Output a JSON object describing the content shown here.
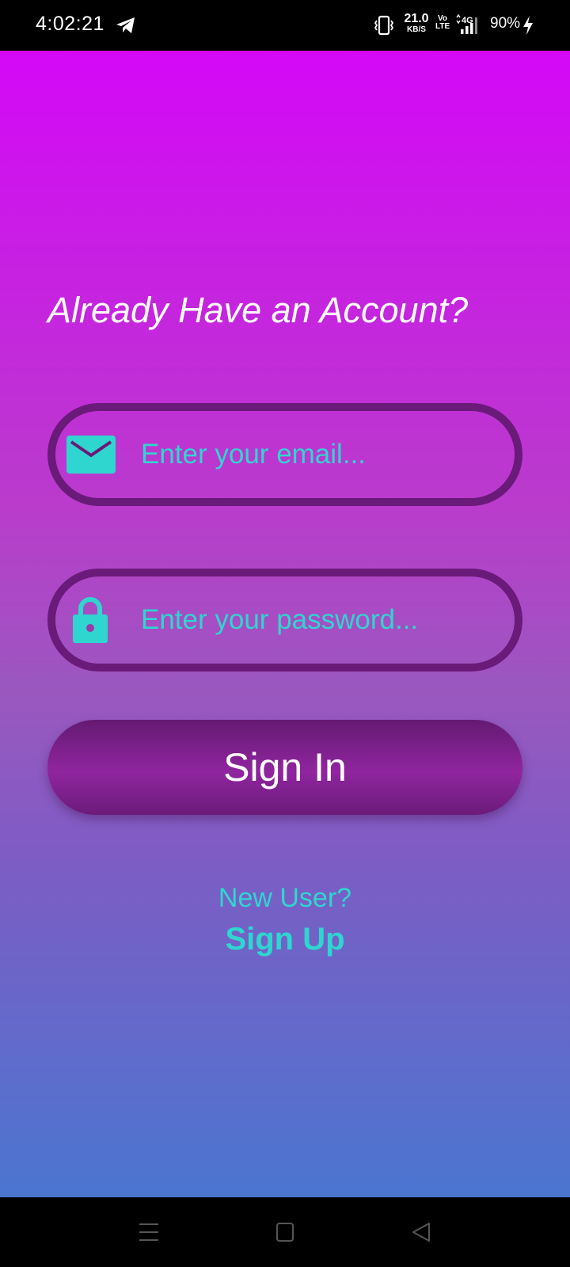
{
  "status_bar": {
    "time": "4:02:21",
    "speed_value": "21.0",
    "speed_unit": "KB/S",
    "volte_top": "Vo",
    "volte_bottom": "LTE",
    "network_type": "4G",
    "battery": "90%",
    "icons": [
      "telegram-icon",
      "vibrate-icon",
      "signal-icon",
      "charging-icon"
    ]
  },
  "login": {
    "heading": "Already Have an Account?",
    "email_placeholder": "Enter your email...",
    "password_placeholder": "Enter your password...",
    "sign_in_label": "Sign In",
    "new_user_text": "New User?",
    "sign_up_label": "Sign Up"
  },
  "nav_bar": {
    "icons": [
      "menu-icon",
      "home-icon",
      "back-icon"
    ]
  },
  "colors": {
    "gradient_top": "#d408f7",
    "gradient_bottom": "#4a76d0",
    "accent": "#2fd6cf",
    "field_border": "#6a1a78",
    "button": "#90259f"
  }
}
